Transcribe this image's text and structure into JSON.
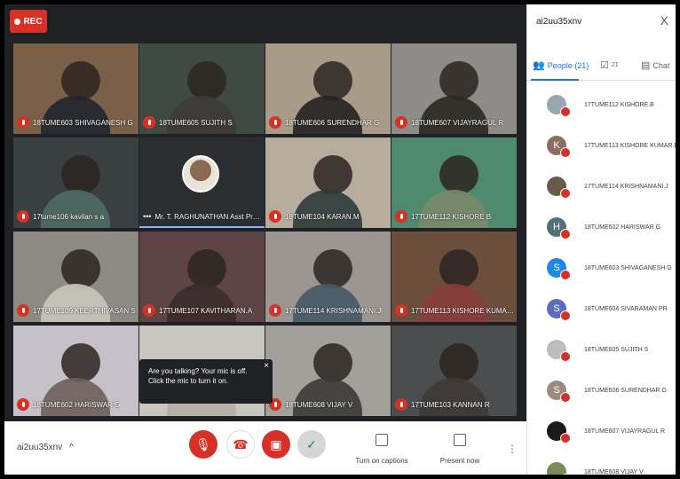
{
  "recording": {
    "label": "REC"
  },
  "tiles": [
    {
      "name": "18TUME603 SHIVAGANESH G"
    },
    {
      "name": "18TUME605 SUJITH S"
    },
    {
      "name": "18TUME606 SURENDHAR G"
    },
    {
      "name": "18TUME607 VIJAYRAGUL R"
    },
    {
      "name": "17tume106 kavilan s a"
    },
    {
      "name": "Mr. T. RAGHUNATHAN Asst Prof..."
    },
    {
      "name": "18TUME104 KARAN.M"
    },
    {
      "name": "17TUME112 KISHORE B"
    },
    {
      "name": "17TUME109 KEERTHIVASAN S"
    },
    {
      "name": "17TUME107 KAVITHARAN.A"
    },
    {
      "name": "17TUME114 KRISHNAMANI.J"
    },
    {
      "name": "17TUME113 KISHORE KUMAR.D"
    },
    {
      "name": "18TUME602 HARISWAR G"
    },
    {
      "name": ""
    },
    {
      "name": "18TUME608 VIJAY V"
    },
    {
      "name": "17TUME103 KANNAN R"
    }
  ],
  "mic_popup": {
    "text": "Are you talking? Your mic is off. Click the mic to turn it on.",
    "close": "×"
  },
  "bottom_bar": {
    "meeting_code": "ai2uu35xnv",
    "expand": "^",
    "captions": "Turn on captions",
    "present": "Present now",
    "more": "⋮"
  },
  "panel": {
    "title": "ai2uu35xnv",
    "close": "X",
    "tabs": {
      "people": "People (21)",
      "activities_count": "21",
      "chat": "Chat"
    },
    "people": [
      {
        "name": "17TUME112 KISHORE.B",
        "initial": "",
        "color": "#9aa6b1"
      },
      {
        "name": "17TUME113 KISHORE KUMAR.D",
        "initial": "K",
        "color": "#8d6e63"
      },
      {
        "name": "17TUME114 KRISHNAMANI.J",
        "initial": "",
        "color": "#6b5a48"
      },
      {
        "name": "18TUME602 HARISWAR G",
        "initial": "H",
        "color": "#546e7a"
      },
      {
        "name": "18TUME603 SHIVAGANESH G",
        "initial": "S",
        "color": "#1e88e5"
      },
      {
        "name": "18TUME604 SIVARAMAN PR",
        "initial": "S",
        "color": "#5c6bc0"
      },
      {
        "name": "18TUME605 SUJITH S",
        "initial": "",
        "color": "#bdbdbd"
      },
      {
        "name": "18TUME606 SURENDHAR G",
        "initial": "S",
        "color": "#a1887f"
      },
      {
        "name": "18TUME607 VIJAYRAGUL R",
        "initial": "",
        "color": "#1a1a1a"
      },
      {
        "name": "18TUME608 VIJAY V",
        "initial": "",
        "color": "#7c8b5a"
      }
    ]
  }
}
